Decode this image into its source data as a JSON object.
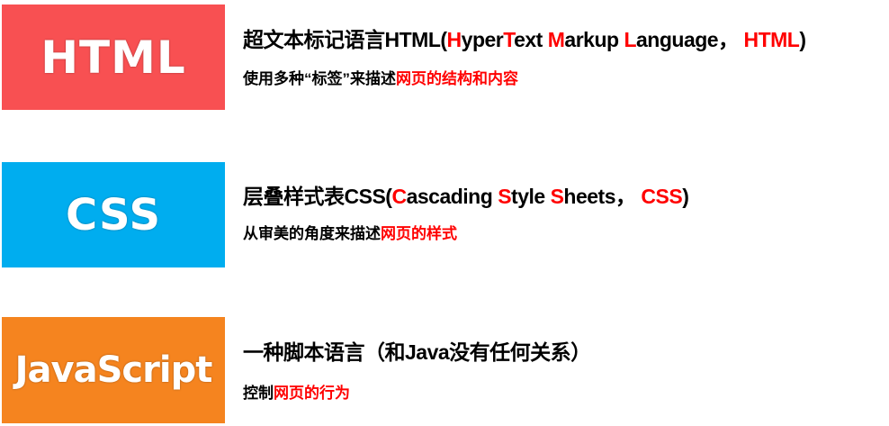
{
  "colors": {
    "html_box": "#F85052",
    "css_box": "#00ADEF",
    "js_box": "#F5841F",
    "highlight": "#FF0000"
  },
  "items": [
    {
      "logo": "HTML",
      "title": [
        {
          "text": "超文本标记语言HTML(",
          "red": false
        },
        {
          "text": "H",
          "red": true
        },
        {
          "text": "yper",
          "red": false
        },
        {
          "text": "T",
          "red": true
        },
        {
          "text": "ext ",
          "red": false
        },
        {
          "text": "M",
          "red": true
        },
        {
          "text": "arkup ",
          "red": false
        },
        {
          "text": "L",
          "red": true
        },
        {
          "text": "anguage， ",
          "red": false
        },
        {
          "text": "HTML",
          "red": true
        },
        {
          "text": ")",
          "red": false
        }
      ],
      "subtitle": [
        {
          "text": "使用多种“标签”来描述",
          "red": false
        },
        {
          "text": "网页的结构和内容",
          "red": true
        }
      ]
    },
    {
      "logo": "CSS",
      "title": [
        {
          "text": "层叠样式表CSS(",
          "red": false
        },
        {
          "text": "C",
          "red": true
        },
        {
          "text": "ascading ",
          "red": false
        },
        {
          "text": "S",
          "red": true
        },
        {
          "text": "tyle ",
          "red": false
        },
        {
          "text": "S",
          "red": true
        },
        {
          "text": "heets， ",
          "red": false
        },
        {
          "text": "CSS",
          "red": true
        },
        {
          "text": ")",
          "red": false
        }
      ],
      "subtitle": [
        {
          "text": "从审美的角度来描述",
          "red": false
        },
        {
          "text": "网页的样式",
          "red": true
        }
      ]
    },
    {
      "logo": "JavaScript",
      "title": [
        {
          "text": "一种脚本语言（和Java没有任何关系）",
          "red": false
        }
      ],
      "subtitle": [
        {
          "text": "控制",
          "red": false
        },
        {
          "text": "网页的行为",
          "red": true
        }
      ]
    }
  ]
}
